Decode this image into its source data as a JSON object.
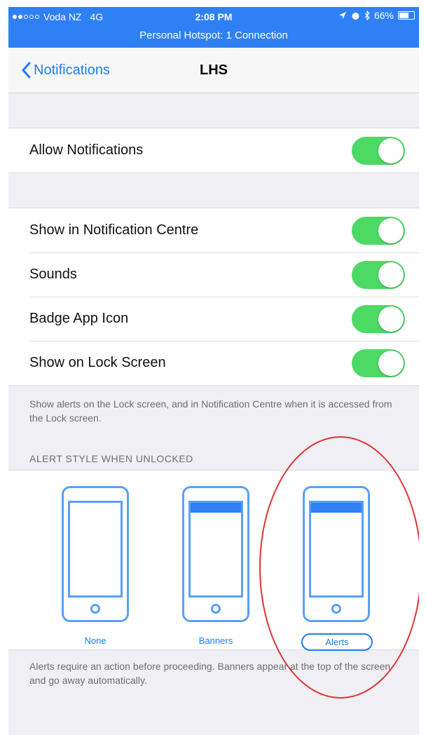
{
  "status_bar": {
    "carrier": "Voda NZ",
    "network": "4G",
    "time": "2:08 PM",
    "battery": "66%",
    "hotspot": "Personal Hotspot: 1 Connection"
  },
  "nav": {
    "back_label": "Notifications",
    "title": "LHS"
  },
  "group1": {
    "allow_notifications": {
      "label": "Allow Notifications",
      "on": true
    }
  },
  "group2": {
    "items": [
      {
        "label": "Show in Notification Centre",
        "on": true
      },
      {
        "label": "Sounds",
        "on": true
      },
      {
        "label": "Badge App Icon",
        "on": true
      },
      {
        "label": "Show on Lock Screen",
        "on": true
      }
    ],
    "footnote": "Show alerts on the Lock screen, and in Notification Centre when it is accessed from the Lock screen."
  },
  "alert_style": {
    "header": "ALERT STYLE WHEN UNLOCKED",
    "options": [
      {
        "label": "None",
        "selected": false
      },
      {
        "label": "Banners",
        "selected": false
      },
      {
        "label": "Alerts",
        "selected": true
      }
    ],
    "footnote": "Alerts require an action before proceeding. Banners appear at the top of the screen and go away automatically."
  },
  "colors": {
    "accent": "#1f7cf5",
    "status_bar": "#2f7ff5",
    "toggle_on": "#4cd964",
    "annotation": "#e03131"
  }
}
